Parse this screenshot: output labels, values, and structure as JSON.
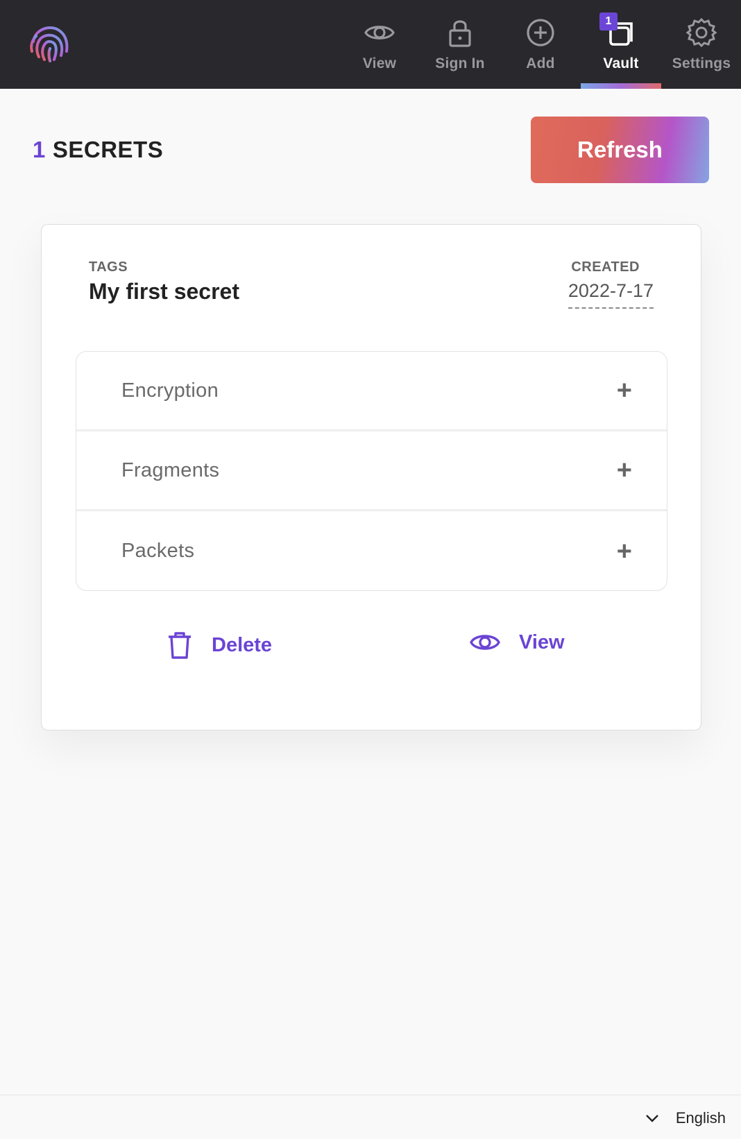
{
  "nav": {
    "items": [
      {
        "label": "View",
        "icon": "eye-icon"
      },
      {
        "label": "Sign In",
        "icon": "lock-icon"
      },
      {
        "label": "Add",
        "icon": "plus-circle-icon"
      },
      {
        "label": "Vault",
        "icon": "vault-icon",
        "badge": "1",
        "active": true
      },
      {
        "label": "Settings",
        "icon": "gear-icon"
      }
    ]
  },
  "header": {
    "count": "1",
    "title": "SECRETS",
    "refresh_label": "Refresh"
  },
  "secret": {
    "tags_label": "TAGS",
    "tags_value": "My first secret",
    "created_label": "CREATED",
    "created_value": "2022-7-17",
    "sections": [
      {
        "label": "Encryption",
        "icon": "plus-icon"
      },
      {
        "label": "Fragments",
        "icon": "plus-icon"
      },
      {
        "label": "Packets",
        "icon": "plus-icon"
      }
    ],
    "delete_label": "Delete",
    "view_label": "View"
  },
  "footer": {
    "language": "English"
  },
  "colors": {
    "topbar": "#29282c",
    "accent": "#6a44d4",
    "background": "#f9f9f9"
  }
}
